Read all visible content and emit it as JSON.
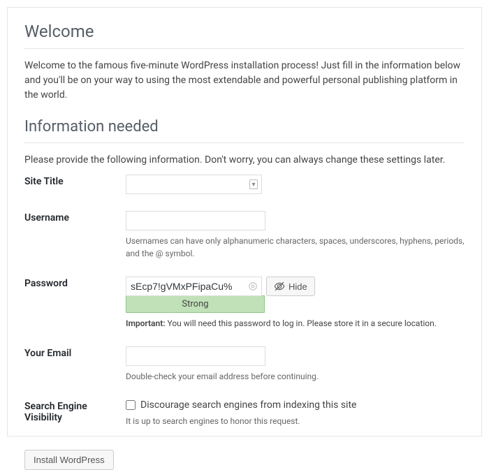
{
  "welcome": {
    "heading": "Welcome",
    "intro": "Welcome to the famous five-minute WordPress installation process! Just fill in the information below and you'll be on your way to using the most extendable and powerful personal publishing platform in the world."
  },
  "info": {
    "heading": "Information needed",
    "intro": "Please provide the following information. Don't worry, you can always change these settings later."
  },
  "fields": {
    "site_title": {
      "label": "Site Title",
      "value": ""
    },
    "username": {
      "label": "Username",
      "value": "",
      "hint": "Usernames can have only alphanumeric characters, spaces, underscores, hyphens, periods, and the @ symbol."
    },
    "password": {
      "label": "Password",
      "value": "sEcp7!gVMxPFipaCu%",
      "hide_label": "Hide",
      "strength": "Strong",
      "important_label": "Important:",
      "important_text": " You will need this password to log in. Please store it in a secure location."
    },
    "email": {
      "label": "Your Email",
      "value": "",
      "hint": "Double-check your email address before continuing."
    },
    "search_visibility": {
      "label": "Search Engine Visibility",
      "checkbox_label": "Discourage search engines from indexing this site",
      "hint": "It is up to search engines to honor this request."
    }
  },
  "submit": {
    "label": "Install WordPress"
  }
}
